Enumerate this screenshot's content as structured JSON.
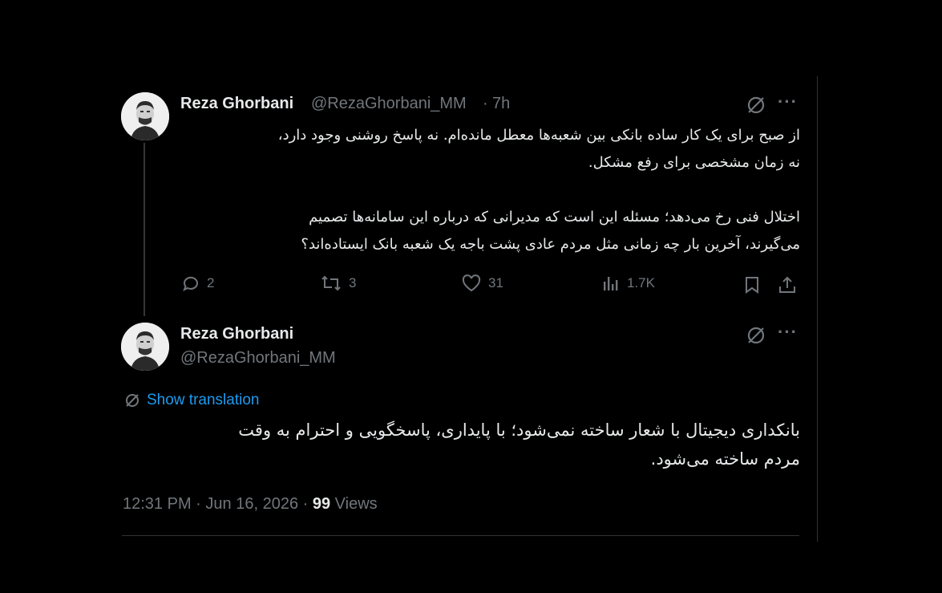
{
  "tweet1": {
    "name": "Reza Ghorbani",
    "handle": "@RezaGhorbani_MM",
    "separator": "·",
    "time": "7h",
    "text": "از صبح برای یک کار ساده بانکی بین شعبه‌ها معطل مانده‌ام. نه پاسخ روشنی وجود دارد،\nنه زمان مشخصی برای رفع مشکل.\n\nاختلال فنی رخ می‌دهد؛ مسئله این است که مدیرانی که درباره این سامانه‌ها تصمیم\nمی‌گیرند، آخرین بار چه زمانی مثل مردم عادی پشت باجه یک شعبه بانک ایستاده‌اند؟",
    "replies": "2",
    "reposts": "3",
    "likes": "31",
    "views": "1.7K"
  },
  "tweet2": {
    "name": "Reza Ghorbani",
    "handle": "@RezaGhorbani_MM",
    "translate_label": "Show translation",
    "text": "بانکداری دیجیتال با شعار ساخته نمی‌شود؛ با پایداری، پاسخگویی و احترام به وقت\nمردم ساخته می‌شود.",
    "time": "12:31 PM",
    "date": "Jun 16, 2026",
    "views_count": "99",
    "views_label": "Views",
    "dot": "·"
  },
  "colors": {
    "accent": "#1d9bf0",
    "muted": "#71767b",
    "text": "#e7e9ea",
    "background": "#000000"
  },
  "icons": [
    "grok-icon",
    "more-icon",
    "reply-icon",
    "repost-icon",
    "like-icon",
    "views-icon",
    "bookmark-icon",
    "share-icon",
    "translate-icon"
  ]
}
